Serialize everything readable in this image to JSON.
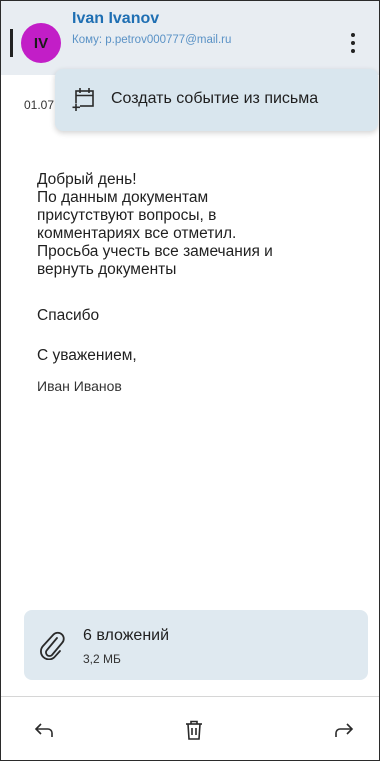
{
  "header": {
    "avatar_initials": "IV",
    "sender_name": "Ivan Ivanov",
    "recipient": "Кому: p.petrov000777@mail.ru",
    "menu_icon": "more-vertical-icon"
  },
  "message": {
    "date": "01.07",
    "body": "Добрый день!\nПо данным документам\nприсутствуют вопросы, в\nкомментариях все отметил.\nПросьба учесть все замечания и\nвернуть документы",
    "thanks": "Спасибо",
    "regards": "С уважением,",
    "signature": "Иван Иванов"
  },
  "popup_menu": {
    "icon": "calendar-add-icon",
    "label": "Создать событие из письма"
  },
  "attachments": {
    "icon": "paperclip-icon",
    "title": "6 вложений",
    "size": "3,2 МБ"
  },
  "bottom_bar": {
    "reply_icon": "reply-icon",
    "delete_icon": "trash-icon",
    "forward_icon": "forward-icon"
  },
  "colors": {
    "header_bg": "#e8edf2",
    "avatar": "#c21ec7",
    "sender_name": "#1f6fb3",
    "popup_bg": "#d9e6ee",
    "attachment_bg": "#dfe9f0"
  }
}
